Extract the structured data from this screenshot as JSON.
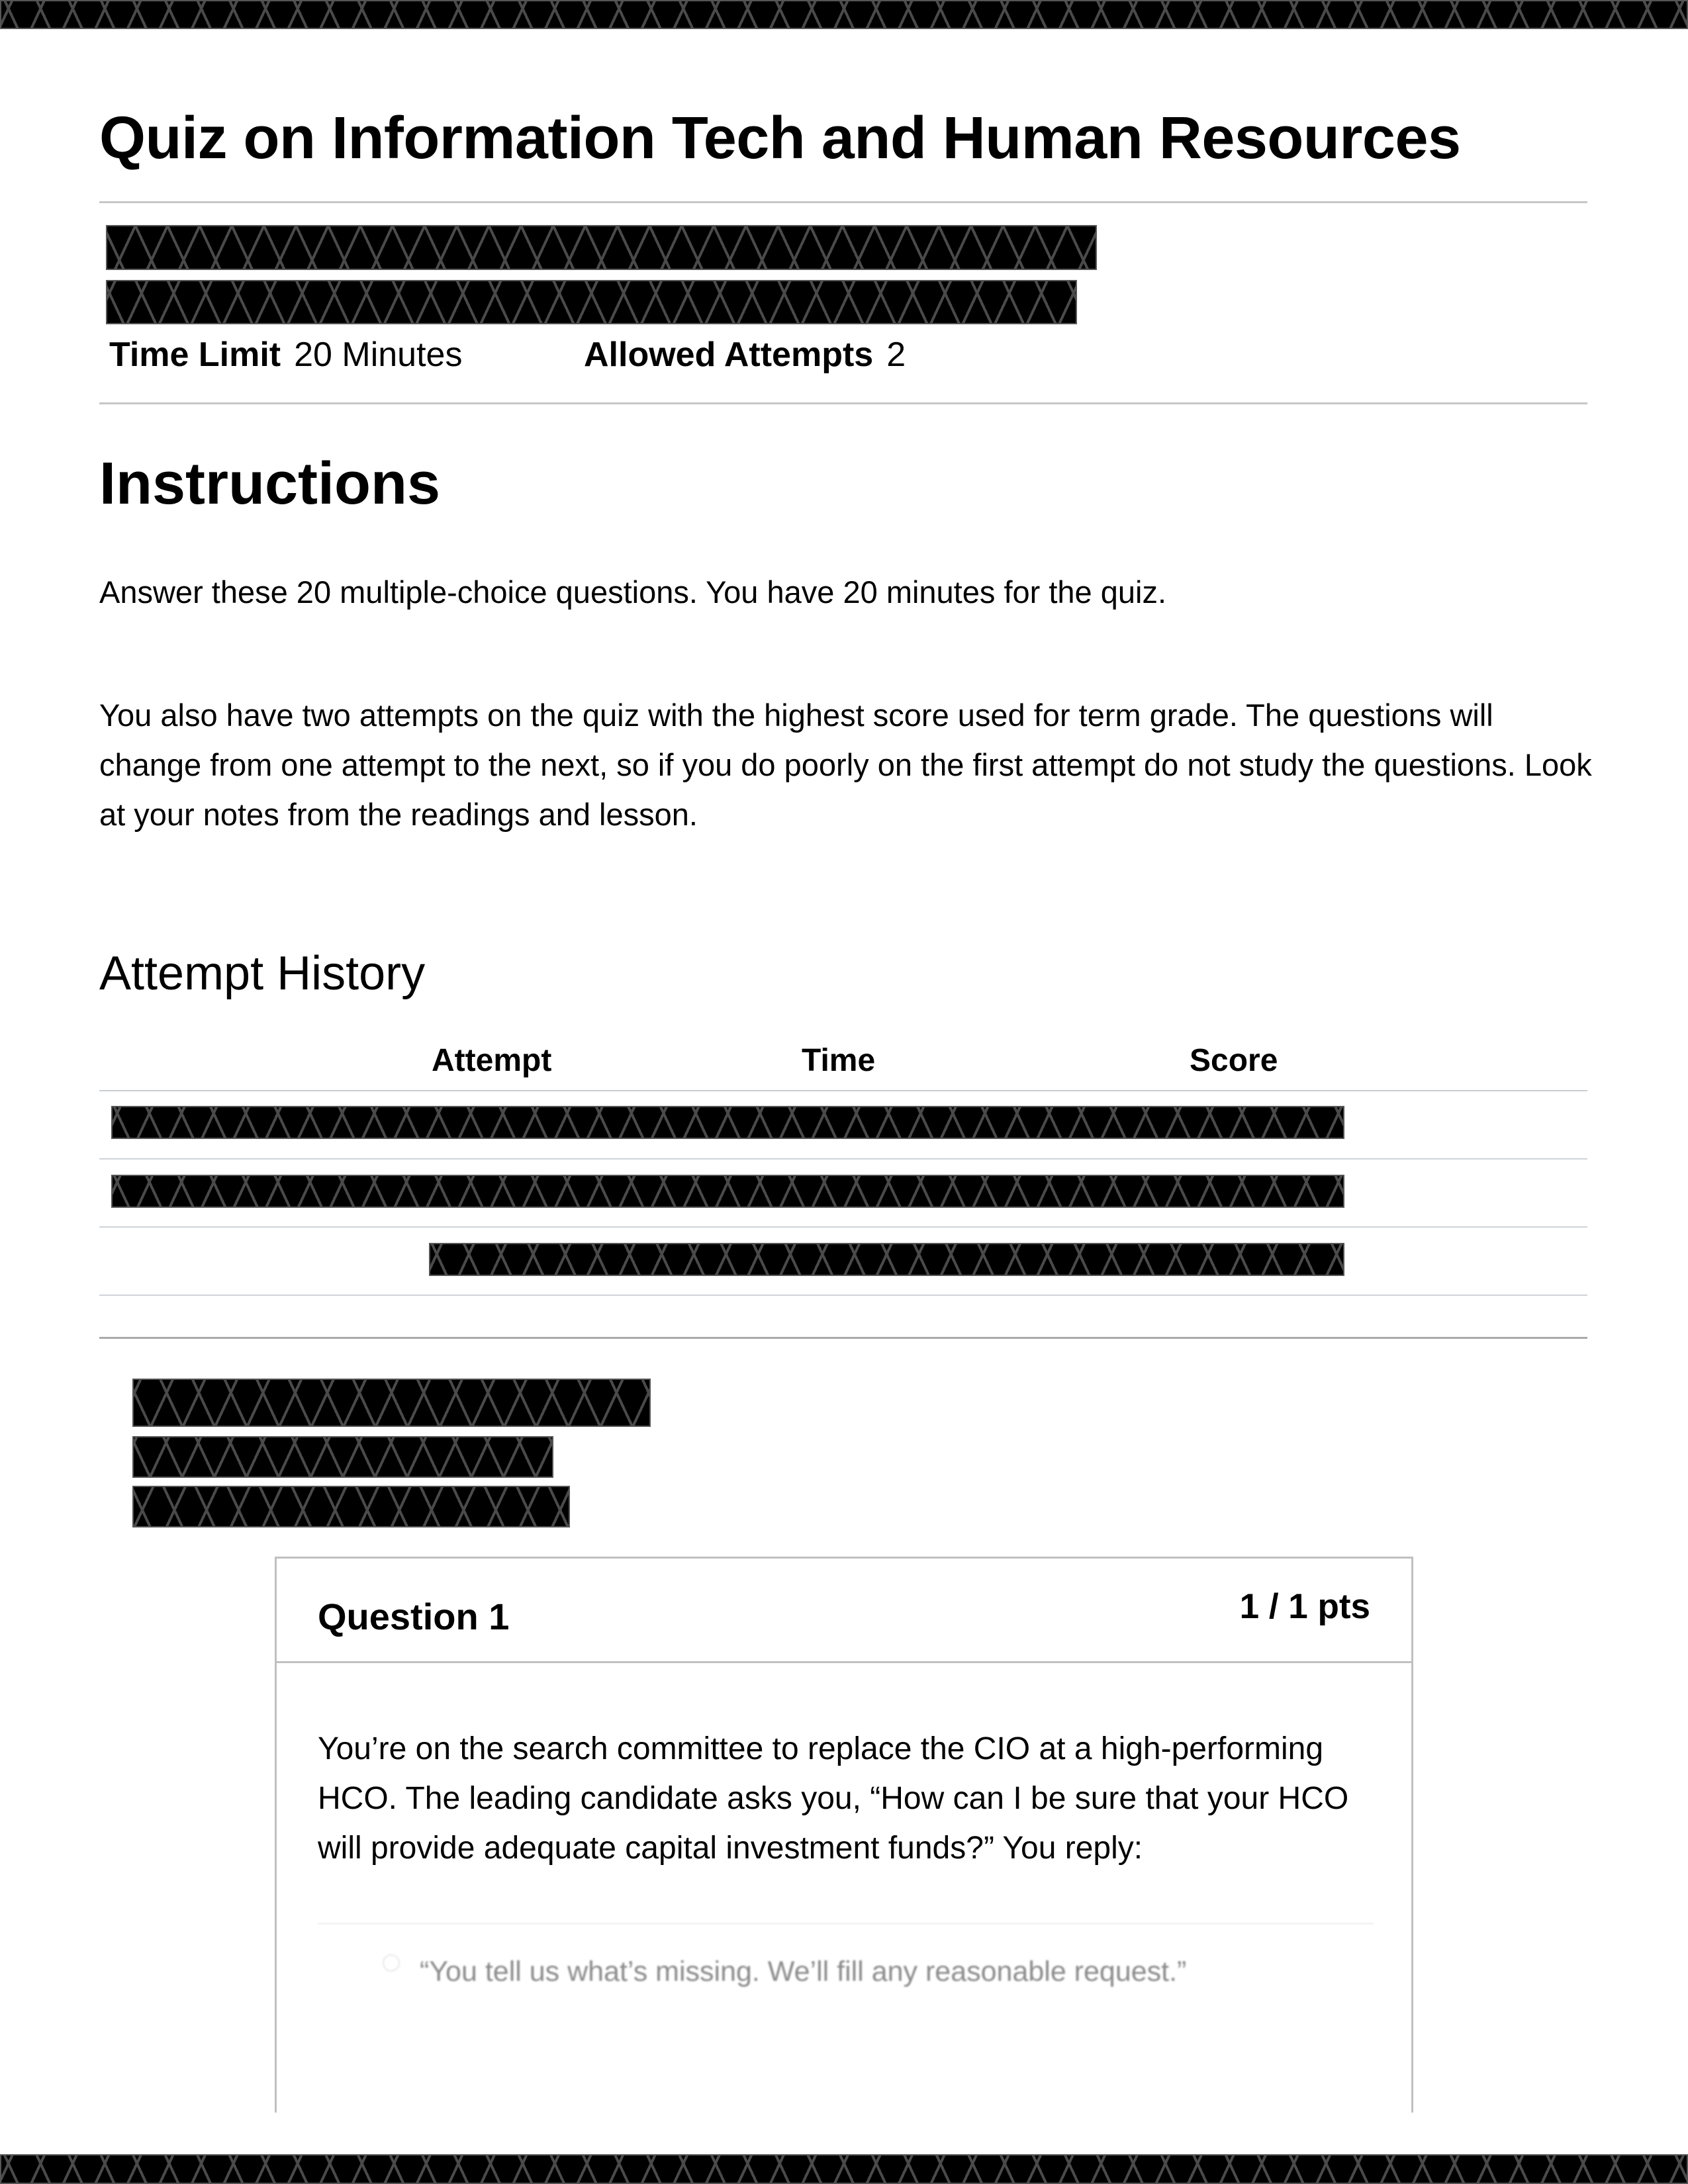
{
  "page": {
    "title": "Quiz on Information Tech and Human Resources",
    "meta": {
      "time_limit_label": "Time Limit",
      "time_limit_value": "20 Minutes",
      "allowed_attempts_label": "Allowed Attempts",
      "allowed_attempts_value": "2"
    },
    "instructions": {
      "heading": "Instructions",
      "paragraphs": [
        "Answer these 20 multiple-choice questions. You have 20 minutes for the quiz.",
        "You also have two attempts on the quiz with the highest score used for term grade. The questions will change from one attempt to the next, so if you do poorly on the first attempt do not study the questions. Look at your notes from the readings and lesson."
      ]
    },
    "attempt_history": {
      "heading": "Attempt History",
      "columns": [
        "Attempt",
        "Time",
        "Score"
      ],
      "rows": [
        "[redacted]",
        "[redacted]",
        "[redacted]"
      ]
    },
    "question": {
      "title": "Question 1",
      "points": "1 / 1 pts",
      "text": "You’re on the search committee to replace the CIO at a high-performing HCO. The leading candidate asks you, “How can I be sure that your HCO will provide adequate capital investment funds?” You reply:",
      "options": [
        {
          "label": "“You tell us what’s missing. We’ll fill any reasonable request.”",
          "selected": false
        }
      ]
    },
    "colors": {
      "rule": "#c7c7c7",
      "card_border": "#c0c0c0",
      "option_text": "#8a8a8a",
      "redaction": "#000000"
    }
  }
}
